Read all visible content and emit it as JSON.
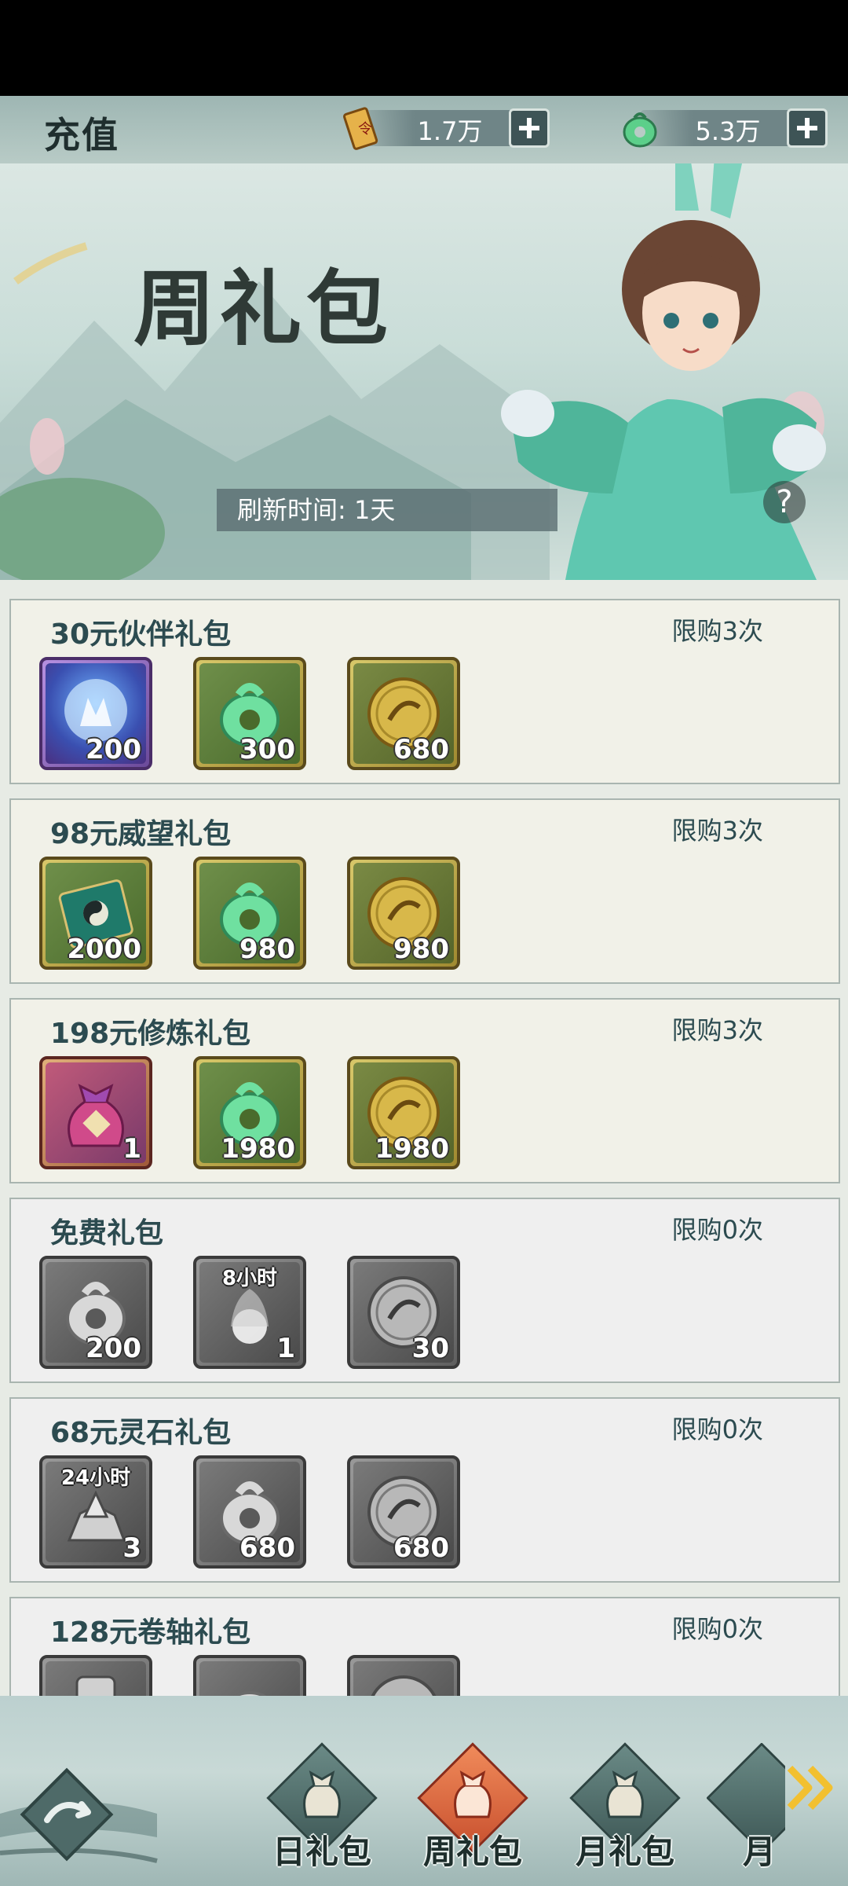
{
  "header": {
    "title": "充值",
    "currencies": [
      {
        "icon": "scroll-token-icon",
        "value": "1.7万"
      },
      {
        "icon": "jade-pendant-icon",
        "value": "5.3万"
      }
    ]
  },
  "banner": {
    "title": "周礼包",
    "refresh_text": "刷新时间: 1天",
    "help_label": "?"
  },
  "packs": [
    {
      "title": "30元伙伴礼包",
      "limit": "限购3次",
      "items": [
        {
          "icon": "spirit-orb-icon",
          "qty": "200"
        },
        {
          "icon": "jade-pendant-icon",
          "qty": "300"
        },
        {
          "icon": "gold-coin-icon",
          "qty": "680"
        }
      ]
    },
    {
      "title": "98元威望礼包",
      "limit": "限购3次",
      "items": [
        {
          "icon": "taiji-scroll-icon",
          "qty": "2000"
        },
        {
          "icon": "jade-pendant-icon",
          "qty": "980"
        },
        {
          "icon": "gold-coin-icon",
          "qty": "980"
        }
      ]
    },
    {
      "title": "198元修炼礼包",
      "limit": "限购3次",
      "items": [
        {
          "icon": "fortune-bag-icon",
          "qty": "1"
        },
        {
          "icon": "jade-pendant-icon",
          "qty": "1980"
        },
        {
          "icon": "gold-coin-icon",
          "qty": "1980"
        }
      ]
    },
    {
      "title": "免费礼包",
      "limit": "限购0次",
      "items": [
        {
          "icon": "jade-pendant-icon",
          "qty": "200"
        },
        {
          "icon": "spirit-flame-icon",
          "qty": "1",
          "timer": "8小时"
        },
        {
          "icon": "silver-coin-icon",
          "qty": "30"
        }
      ]
    },
    {
      "title": "68元灵石礼包",
      "limit": "限购0次",
      "items": [
        {
          "icon": "spirit-stone-icon",
          "qty": "3",
          "timer": "24小时"
        },
        {
          "icon": "jade-pendant-icon",
          "qty": "680"
        },
        {
          "icon": "silver-coin-icon",
          "qty": "680"
        }
      ]
    },
    {
      "title": "128元卷轴礼包",
      "limit": "限购0次",
      "items": [
        {
          "icon": "scroll-icon",
          "qty": ""
        },
        {
          "icon": "jade-pendant-icon",
          "qty": ""
        },
        {
          "icon": "silver-coin-icon",
          "qty": ""
        }
      ]
    }
  ],
  "nav": {
    "back_icon": "back-arrow-icon",
    "tabs": [
      {
        "label": "日礼包",
        "active": false
      },
      {
        "label": "周礼包",
        "active": true
      },
      {
        "label": "月礼包",
        "active": false
      },
      {
        "label": "月",
        "active": false
      }
    ],
    "more_icon": "double-chevron-right-icon"
  },
  "colors": {
    "accent_active_tab": "#e0703f",
    "pack_text": "#2c4b50",
    "gold_frame": "#c8b450"
  }
}
